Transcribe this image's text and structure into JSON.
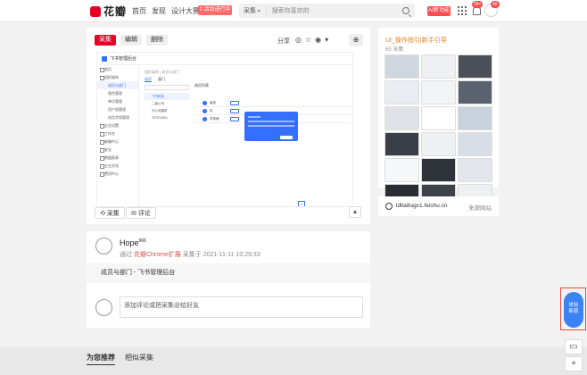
{
  "header": {
    "logo_text": "花瓣",
    "nav": [
      "首页",
      "发现",
      "设计大赛"
    ],
    "promo": "1 活动进行中",
    "search_category": "采集",
    "search_placeholder": "搜索你喜欢的",
    "ai_button": "AI新功能",
    "badge_messages": "99+",
    "badge_profile": "46"
  },
  "pin": {
    "collect_button": "采集",
    "edit_button": "编辑",
    "delete_button": "删除",
    "share_label": "分享",
    "bottom_collect": "采集",
    "bottom_comment": "评论",
    "screenshot": {
      "app_title": "飞书管理后台",
      "sidebar": [
        "首页",
        "组织架构",
        "成员与部门",
        "角色管理",
        "单位管理",
        "用户组管理",
        "成员字段管理",
        "企业设置",
        "工作台",
        "邮箱中心",
        "安全",
        "数据报表",
        "企业文化",
        "费用中心"
      ],
      "breadcrumb": "组织架构 / 成员与部门",
      "tabs": [
        "成员",
        "部门"
      ],
      "table_title": "成员列表",
      "rows": [
        {
          "name": "潘宝",
          "phone": "+86 13800000000"
        },
        {
          "name": "张",
          "phone": "+86 13800000000"
        },
        {
          "name": "李易峰",
          "phone": "+86 13800000000"
        }
      ],
      "tree": [
        "飞书科技",
        "二级公司",
        "分公司建筑",
        "TESTDATA"
      ],
      "page": "1"
    }
  },
  "board": {
    "title": "UI_操作指引|新手引导",
    "meta": "65 采集",
    "thumb_colors": [
      "#cfd6de",
      "#eef0f3",
      "#4a4f58",
      "#e9edf1",
      "#f3f4f6",
      "#5a6270",
      "#dfe3e8",
      "#ffffff",
      "#c9d2dc",
      "#3a3f47",
      "#eef1f4",
      "#d8dee5",
      "#f6f7f9",
      "#2f343b",
      "#e3e7ec",
      "#2a2d33",
      "#3c414a",
      "#eef0f2"
    ]
  },
  "site": {
    "name": "ldlta8ugx1.feishu.cn",
    "link": "来源网站"
  },
  "author": {
    "name": "Hope",
    "sup": "666",
    "via_prefix": "通过",
    "via_link": "花瓣Chrome扩展",
    "via_suffix": "采集于 2021-11-11 10:29:33",
    "description": "成员与部门 - 飞书管理后台",
    "comment_placeholder": "添加评论或把采集@给好友"
  },
  "bottom_tabs": [
    "为您推荐",
    "相似采集"
  ],
  "new_version": [
    "体验",
    "新版"
  ]
}
